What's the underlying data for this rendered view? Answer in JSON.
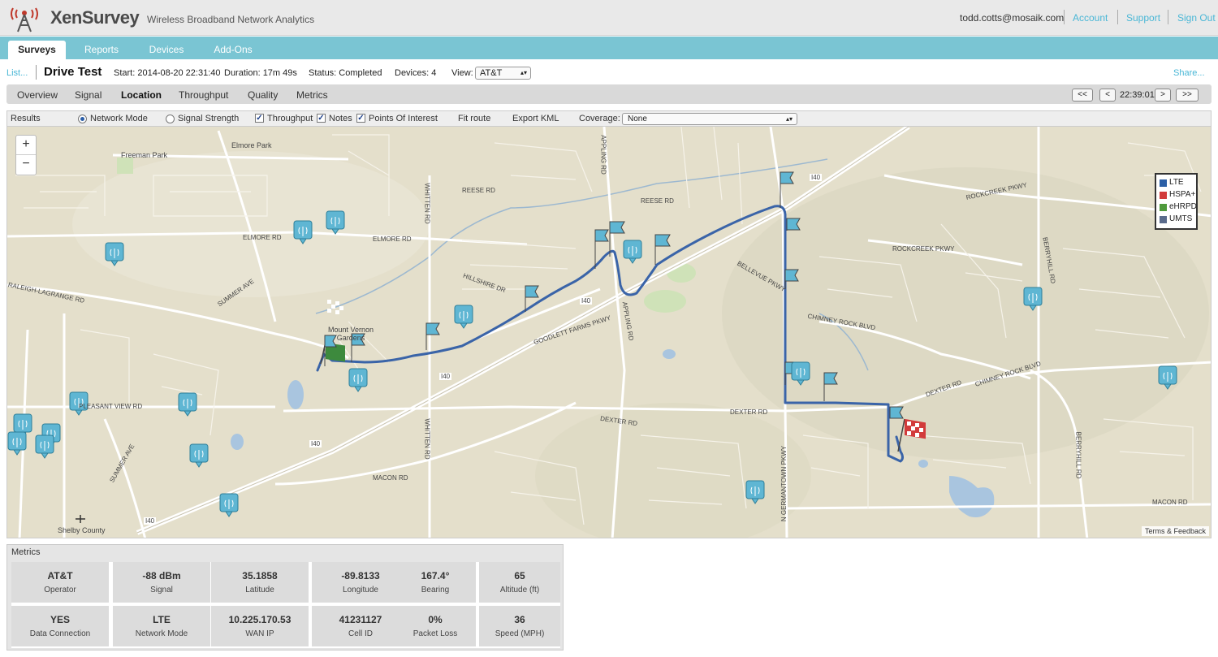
{
  "header": {
    "brand": "XenSurvey",
    "tagline": "Wireless Broadband Network Analytics",
    "user_email": "todd.cotts@mosaik.com",
    "links": {
      "account": "Account",
      "support": "Support",
      "sign_out": "Sign Out"
    }
  },
  "nav": {
    "tabs": [
      "Surveys",
      "Reports",
      "Devices",
      "Add-Ons"
    ],
    "active": "Surveys"
  },
  "survey": {
    "list_link": "List...",
    "title": "Drive Test",
    "start": "Start: 2014-08-20 22:31:40",
    "duration": "Duration: 17m 49s",
    "status": "Status: Completed",
    "devices": "Devices: 4",
    "view_label": "View:",
    "view_value": "AT&T",
    "share": "Share..."
  },
  "subtabs": {
    "items": [
      "Overview",
      "Signal",
      "Location",
      "Throughput",
      "Quality",
      "Metrics"
    ],
    "active": "Location",
    "controls": {
      "first": "<<",
      "prev": "<",
      "time": "22:39:01",
      "next": ">",
      "last": ">>"
    }
  },
  "options": {
    "results": "Results",
    "network_mode": "Network Mode",
    "signal_strength": "Signal Strength",
    "throughput": "Throughput",
    "notes": "Notes",
    "poi": "Points Of Interest",
    "fit_route": "Fit route",
    "export_kml": "Export KML",
    "coverage_label": "Coverage:",
    "coverage_value": "None",
    "selected_mode": "Network Mode",
    "checked": [
      "Throughput",
      "Notes",
      "Points Of Interest"
    ]
  },
  "map": {
    "zoom_in": "+",
    "zoom_out": "−",
    "terms": "Terms & Feedback",
    "legend": [
      {
        "label": "LTE",
        "color": "#2b5fa6"
      },
      {
        "label": "HSPA+",
        "color": "#d23b3b"
      },
      {
        "label": "eHRPD",
        "color": "#4f9a3c"
      },
      {
        "label": "UMTS",
        "color": "#5a6b8c"
      }
    ],
    "route_color": "#3a64a8",
    "labels": {
      "freeman_park": "Freeman Park",
      "elmore_park": "Elmore Park",
      "elmore_rd": "ELMORE RD",
      "reese_rd": "REESE RD",
      "raleigh": "RALEIGH-LAGRANGE RD",
      "hillshire": "HILLSHIRE DR",
      "i40": "I40",
      "goodlett": "GOODLETT FARMS PKWY",
      "dexter": "DEXTER RD",
      "macon": "MACON RD",
      "chimney": "CHIMNEY ROCK BLVD",
      "bellevue": "BELLEVUE PKWY",
      "rockcreek": "ROCKCREEK PKWY",
      "mount_vernon": "Mount Vernon Gardens",
      "shelby_county": "Shelby County",
      "summer": "SUMMER AVE",
      "pleasant": "PLEASANT VIEW RD",
      "whitten": "WHITTEN RD",
      "appling": "APPLING RD",
      "germantown": "N GERMANTOWN PKWY",
      "berryhill": "BERRYHILL RD"
    }
  },
  "metrics": {
    "title": "Metrics",
    "cells": [
      {
        "value": "AT&T",
        "label": "Operator"
      },
      {
        "value": "-88 dBm",
        "label": "Signal"
      },
      {
        "value": "35.1858",
        "label": "Latitude"
      },
      {
        "value": "-89.8133",
        "label": "Longitude"
      },
      {
        "value": "167.4°",
        "label": "Bearing"
      },
      {
        "value": "65",
        "label": "Altitude (ft)"
      },
      {
        "value": "YES",
        "label": "Data Connection"
      },
      {
        "value": "LTE",
        "label": "Network Mode"
      },
      {
        "value": "10.225.170.53",
        "label": "WAN IP"
      },
      {
        "value": "41231127",
        "label": "Cell ID"
      },
      {
        "value": "0%",
        "label": "Packet Loss"
      },
      {
        "value": "36",
        "label": "Speed (MPH)"
      }
    ]
  }
}
